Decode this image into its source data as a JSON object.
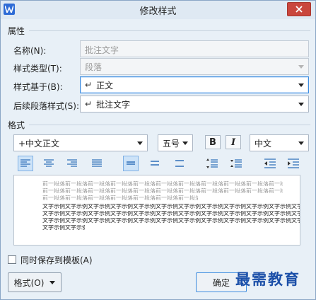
{
  "window": {
    "title": "修改样式"
  },
  "properties": {
    "section_label": "属性",
    "name_label": "名称(N):",
    "name_value": "批注文字",
    "style_type_label": "样式类型(T):",
    "style_type_value": "段落",
    "based_on_label": "样式基于(B):",
    "based_on_value": "正文",
    "next_style_label": "后续段落样式(S):",
    "next_style_value": "批注文字"
  },
  "format": {
    "section_label": "格式",
    "font_value": "+中文正文",
    "size_value": "五号",
    "bold_label": "B",
    "italic_label": "I",
    "script_value": "中文"
  },
  "preview": {
    "previous_paragraph_text": "前一段落前一段落前一段落前一段落前一段落前一段落前一段落前一段落前一段落前一段落前一段落前一段落前一段落前一段落前一段落前一段落前一段落前一段落",
    "sample_text": "文字示例文字示例文字示例文字示例文字示例文字示例文字示例文字示例文字示例文字示例文字示例文字示例文字示例文字示例文字示例文字示例文字示例文字示例"
  },
  "footer": {
    "save_to_template_label": "同时保存到模板(A)",
    "format_menu_label": "格式(O)",
    "ok_label": "确定",
    "watermark_text": "最需教育"
  },
  "colors": {
    "accent": "#3e8de0",
    "dialog_bg": "#e8f0f7",
    "close_red": "#c9463d"
  }
}
